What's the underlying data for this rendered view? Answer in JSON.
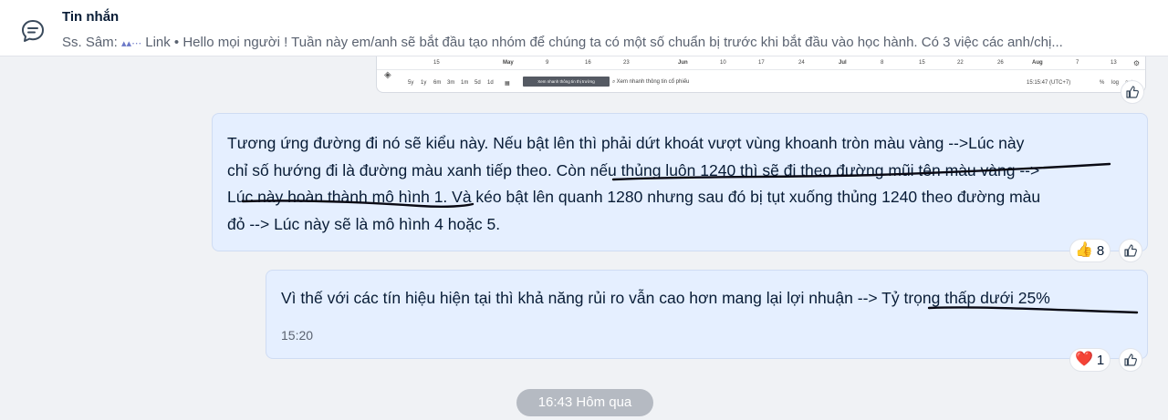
{
  "header": {
    "title": "Tin nhắn",
    "preview_sender": "Ss. Sâm:",
    "preview_text": " Link • Hello mọi người ! Tuần này em/anh sẽ bắt đầu tạo nhóm để chúng ta có một số chuẩn bị trước khi bắt đầu vào học hành. Có 3 việc các anh/chị..."
  },
  "screenshot_card": {
    "timeline_labels": [
      "15",
      "May",
      "9",
      "16",
      "23",
      "Jun",
      "10",
      "17",
      "24",
      "Jul",
      "8",
      "15",
      "22",
      "26",
      "Aug",
      "7",
      "13"
    ],
    "ranges": [
      "5y",
      "1y",
      "6m",
      "3m",
      "1m",
      "5d",
      "1d"
    ],
    "dark_button": "Xem nhanh thông tin thị trường",
    "search_placeholder": "Xem nhanh thông tin cổ phiếu",
    "clock": "15:15:47 (UTC+7)",
    "scale": [
      "%",
      "log",
      "auto"
    ]
  },
  "message1": {
    "line1": "Tương ứng đường đi nó sẽ kiểu này. Nếu bật lên thì phải dứt khoát vượt vùng khoanh tròn màu vàng -->Lúc này",
    "line2": "chỉ số hướng đi là đường màu xanh tiếp theo. Còn nếu thủng luôn 1240 thì sẽ đi theo đường mũi tên màu vàng -->",
    "line3": "Lúc này hoàn thành mô hình 1. Và kéo bật lên quanh 1280 nhưng sau đó bị tụt xuống thủng 1240 theo đường màu",
    "line4": "đỏ --> Lúc này sẽ là mô hình 4 hoặc 5.",
    "reaction_emoji": "👍",
    "reaction_count": "8"
  },
  "message2": {
    "text": "Vì thế với các tín hiệu hiện tại thì khả năng rủi ro vẫn cao hơn mang lại lợi nhuận --> Tỷ trọng thấp dưới 25%",
    "time": "15:20",
    "reaction_emoji": "❤️",
    "reaction_count": "1"
  },
  "date_divider": "16:43 Hôm qua",
  "colors": {
    "bubble": "#e5efff",
    "background": "#f0f2f5",
    "ink": "#0a0a14",
    "date_pill": "#b5bac2"
  }
}
